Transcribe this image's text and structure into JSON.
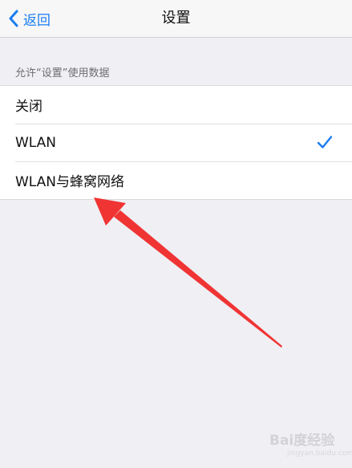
{
  "nav": {
    "back_label": "返回",
    "title": "设置"
  },
  "section": {
    "header": "允许“设置”使用数据",
    "items": [
      {
        "label": "关闭",
        "selected": false
      },
      {
        "label": "WLAN",
        "selected": true
      },
      {
        "label": "WLAN与蜂窝网络",
        "selected": false
      }
    ]
  },
  "annotation": {
    "arrow_color": "#f03434"
  },
  "watermark": {
    "brand": "Bai度经验",
    "url": "jingyan.baidu.com"
  },
  "colors": {
    "accent": "#1a7cf0",
    "background": "#efeff4"
  }
}
